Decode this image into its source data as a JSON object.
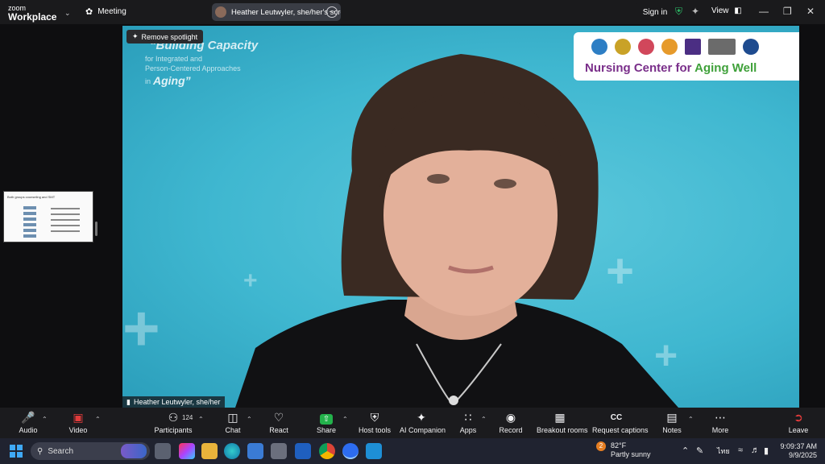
{
  "titlebar": {
    "brand_top": "zoom",
    "brand_bottom": "Workplace",
    "meeting_label": "Meeting",
    "share_pill_text": "Heather Leutwyler, she/her's screen",
    "sign_in": "Sign in",
    "view": "View"
  },
  "video": {
    "spotlight_button": "Remove spotlight",
    "slide_title": "“Building Capacity",
    "slide_sub1": "for Integrated and",
    "slide_sub2": "Person-Centered Approaches",
    "slide_sub3": "in",
    "slide_aging": "Aging”",
    "center_name_a": "Nursing Center for ",
    "center_name_b": "Aging Well",
    "participant_name": "Heather Leutwyler, she/her"
  },
  "thumbnail": {
    "title": "Both groups counseling and SMT"
  },
  "toolbar": {
    "audio": "Audio",
    "video": "Video",
    "participants": "Participants",
    "participants_count": "124",
    "chat": "Chat",
    "react": "React",
    "share": "Share",
    "host_tools": "Host tools",
    "ai_companion": "AI Companion",
    "apps": "Apps",
    "record": "Record",
    "breakout_rooms": "Breakout rooms",
    "request_captions": "Request captions",
    "notes": "Notes",
    "more": "More",
    "leave": "Leave"
  },
  "taskbar": {
    "search_label": "Search",
    "weather_temp": "82°F",
    "weather_desc": "Partly sunny",
    "weather_badge": "2",
    "lang": "ไทย",
    "time": "9:09:37 AM",
    "date": "9/9/2025"
  },
  "colors": {
    "background_teal": "#3fb7d0",
    "share_green": "#23b24b",
    "mute_red": "#e23b3b"
  }
}
